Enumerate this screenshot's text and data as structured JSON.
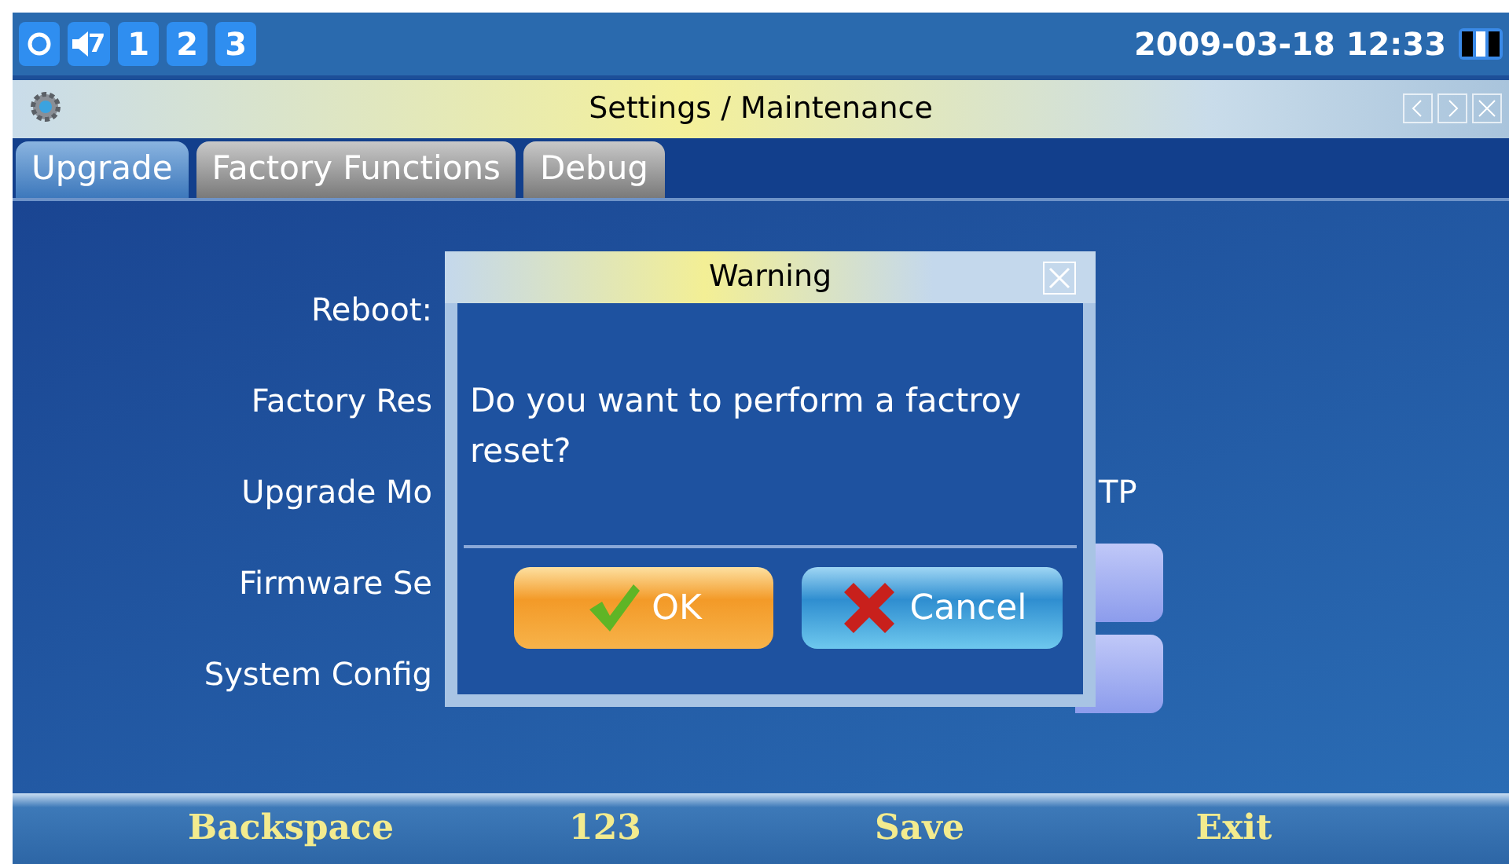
{
  "status_bar": {
    "indicators": [
      {
        "kind": "refresh"
      },
      {
        "kind": "volume",
        "text": "7"
      },
      {
        "kind": "line",
        "text": "1"
      },
      {
        "kind": "line",
        "text": "2"
      },
      {
        "kind": "line",
        "text": "3"
      }
    ],
    "datetime": "2009-03-18 12:33"
  },
  "window": {
    "title": "Settings / Maintenance"
  },
  "tabs": [
    {
      "label": "Upgrade",
      "selected": true
    },
    {
      "label": "Factory Functions",
      "selected": false
    },
    {
      "label": "Debug",
      "selected": false
    }
  ],
  "form": {
    "rows": [
      {
        "label": "Reboot:"
      },
      {
        "label": "Factory Res"
      },
      {
        "label": "Upgrade Mo",
        "value": "TP"
      },
      {
        "label": "Firmware Se",
        "kind": "button"
      },
      {
        "label": "System Config",
        "kind": "button"
      }
    ]
  },
  "dialog": {
    "title": "Warning",
    "message": "Do you want to perform a factroy reset?",
    "buttons": [
      {
        "label": "OK",
        "kind": "ok"
      },
      {
        "label": "Cancel",
        "kind": "cancel"
      }
    ]
  },
  "softkeys": [
    "Backspace",
    "123",
    "Save",
    "Exit"
  ]
}
